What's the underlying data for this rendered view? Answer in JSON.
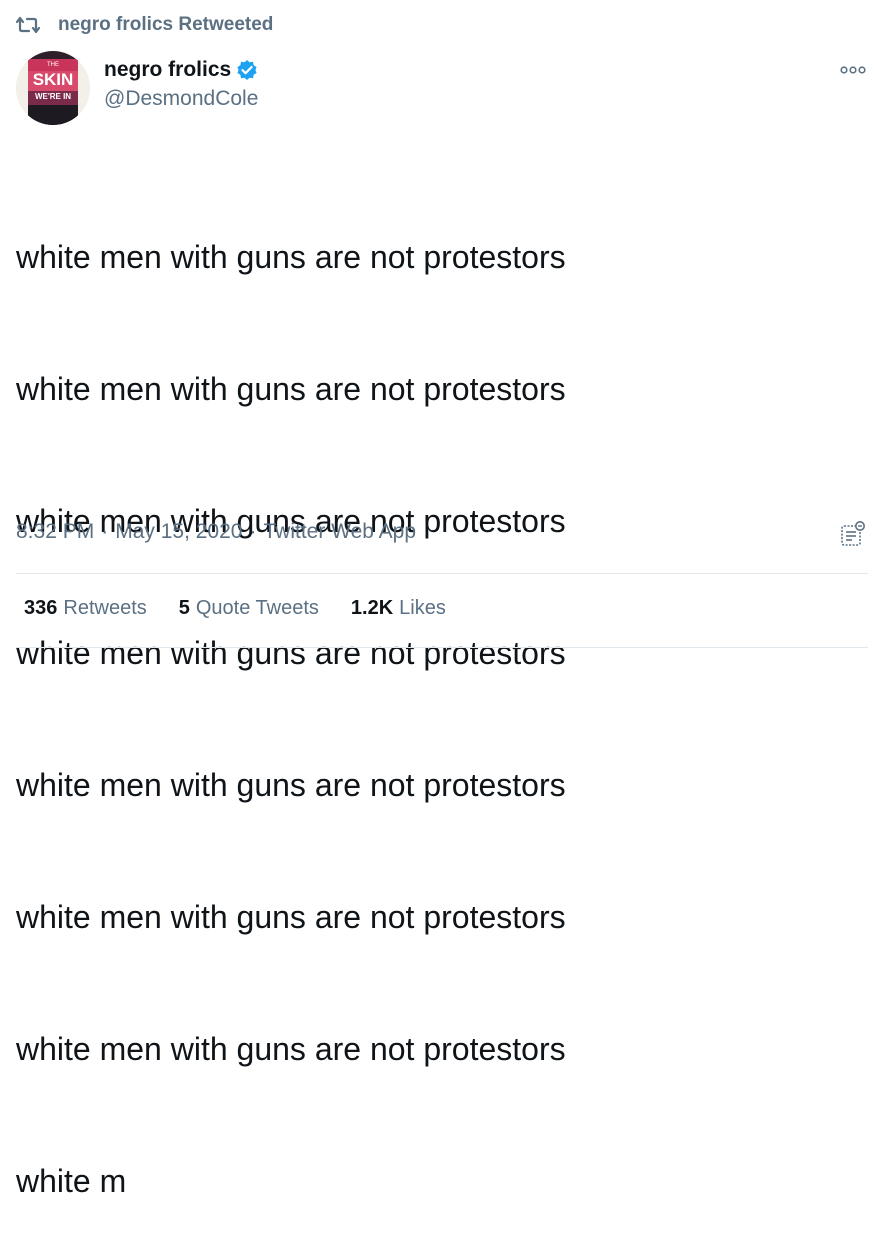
{
  "retweet_header": {
    "text": "negro frolics Retweeted",
    "icon": "retweet-icon"
  },
  "author": {
    "name": "negro frolics",
    "handle": "@DesmondCole",
    "verified": true,
    "avatar_text": {
      "line1": "THE",
      "line2": "SKIN",
      "line3": "WE'RE IN"
    }
  },
  "tweet": {
    "lines": [
      "white men with guns are not protestors",
      "white men with guns are not protestors",
      "white men with guns are not protestors",
      "white men with guns are not protestors",
      "white men with guns are not protestors",
      "white men with guns are not protestors",
      "white men with guns are not protestors",
      "white m"
    ],
    "time": "8:32 PM",
    "date": "May 15, 2020",
    "source": "Twitter Web App",
    "separator": "·"
  },
  "stats": {
    "retweets_count": "336",
    "retweets_label": "Retweets",
    "quotes_count": "5",
    "quotes_label": "Quote Tweets",
    "likes_count": "1.2K",
    "likes_label": "Likes"
  },
  "colors": {
    "secondary_text": "#5b7083",
    "verified_blue": "#1da1f2",
    "primary_text": "#0f1419",
    "divider": "#e1e8ed"
  }
}
